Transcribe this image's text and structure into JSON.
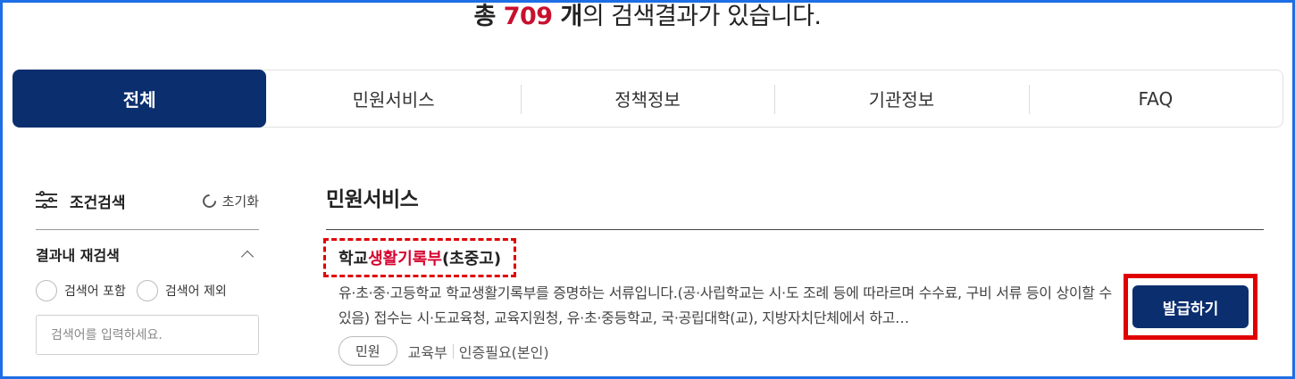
{
  "summary": {
    "prefix": "총 ",
    "count": "709",
    "unit": " 개",
    "suffix": "의 검색결과가 있습니다."
  },
  "tabs": [
    {
      "label": "전체",
      "active": true
    },
    {
      "label": "민원서비스",
      "active": false
    },
    {
      "label": "정책정보",
      "active": false
    },
    {
      "label": "기관정보",
      "active": false
    },
    {
      "label": "FAQ",
      "active": false
    }
  ],
  "sidebar": {
    "title": "조건검색",
    "title_icon": "filter-sliders-icon",
    "reset_label": "초기화",
    "reset_icon": "refresh-icon",
    "research_title": "결과내 재검색",
    "include_label": "검색어 포함",
    "exclude_label": "검색어 제외",
    "search_placeholder": "검색어를 입력하세요."
  },
  "main": {
    "section_title": "민원서비스",
    "results": [
      {
        "title_pre": "학교",
        "title_highlight": "생활기록부",
        "title_post": "(초중고)",
        "description": "유·초·중·고등학교 학교생활기록부를 증명하는 서류입니다.(공·사립학교는 시·도 조례 등에 따라르며 수수료, 구비 서류 등이 상이할 수 있음) 접수는 시·도교육청, 교육지원청, 유·초·중등학교, 국·공립대학(교), 지방자치단체에서 하고…",
        "chip": "민원",
        "org": "교육부",
        "auth": "인증필요(본인)",
        "action_label": "발급하기"
      }
    ]
  },
  "colors": {
    "primary": "#0b2e6f",
    "highlight": "#d6002e",
    "annotation": "#e00000",
    "frame": "#1e6ee6"
  }
}
